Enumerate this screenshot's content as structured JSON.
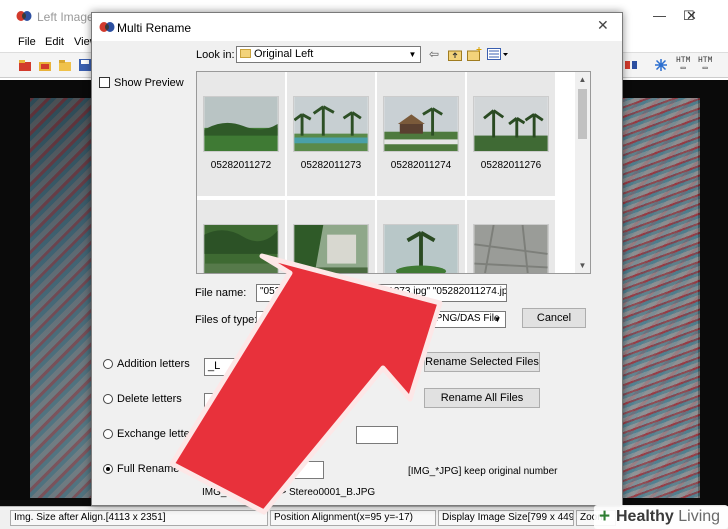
{
  "app": {
    "title": "Left Image(E",
    "menu": [
      "File",
      "Edit",
      "View"
    ],
    "toolbar_right": [
      "HTM",
      "HTM"
    ],
    "status": [
      "Img. Size after Align.[4113 x 2351]",
      "Position Alignment(x=95 y=-17)",
      "Display Image Size[799 x 449]",
      "Zoom"
    ]
  },
  "dialog": {
    "title": "Multi Rename",
    "show_preview_label": "Show Preview",
    "look_in_label": "Look in:",
    "look_in_value": "Original Left",
    "thumbnails": [
      {
        "label": "05282011272"
      },
      {
        "label": "05282011273"
      },
      {
        "label": "05282011274"
      },
      {
        "label": "05282011276"
      },
      {
        "label": ""
      },
      {
        "label": ""
      },
      {
        "label": ""
      },
      {
        "label": ""
      }
    ],
    "file_name_label": "File name:",
    "file_name_value": "\"05282011272.jpg\" \"05282011273.jpg\" \"05282011274.jpg\"",
    "files_of_type_label": "Files of type:",
    "files_of_type_value": "JPS/MPO/BMP/JPG/STJ/BMP/TIF/GIF/PNG/DAS File",
    "cancel_label": "Cancel",
    "options": [
      {
        "label": "Addition letters",
        "selected": false
      },
      {
        "label": "Delete letters",
        "selected": false
      },
      {
        "label": "Exchange letters",
        "selected": false
      },
      {
        "label": "Full Rename",
        "selected": true
      }
    ],
    "addition_value": "_L",
    "delete_value": "_L",
    "full_rename_value": "Stereo",
    "rename_selected_label": "Rename Selected Files",
    "rename_all_label": "Rename All Files",
    "keep_original_label": "[IMG_*JPG] keep original number",
    "example_text": "IMG_0123.JPG --> Stereo0001_B.JPG"
  },
  "overlay": {
    "arrow_color": "#e8313b",
    "watermark_plus": "+",
    "watermark_word1": "Healthy",
    "watermark_word2": "Living"
  }
}
